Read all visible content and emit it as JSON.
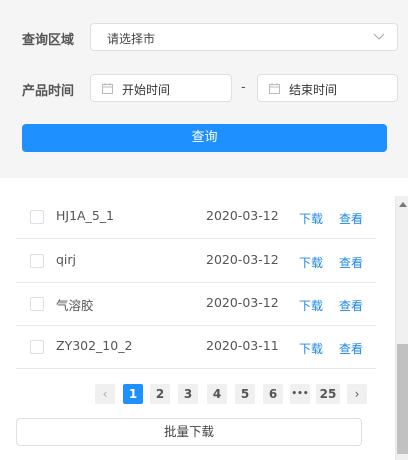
{
  "search": {
    "region_label": "查询区域",
    "region_value": "请选择市",
    "time_label": "产品时间",
    "start_placeholder": "开始时间",
    "date_separator": "-",
    "end_placeholder": "结束时间",
    "query_button": "查询"
  },
  "results": {
    "rows": [
      {
        "name": "HJ1A_5_1",
        "date": "2020-03-12",
        "download": "下载",
        "view": "查看"
      },
      {
        "name": "qirj",
        "date": "2020-03-12",
        "download": "下载",
        "view": "查看"
      },
      {
        "name": "气溶胶",
        "date": "2020-03-12",
        "download": "下载",
        "view": "查看"
      },
      {
        "name": "ZY302_10_2",
        "date": "2020-03-11",
        "download": "下载",
        "view": "查看"
      }
    ]
  },
  "pagination": {
    "prev": "‹",
    "pages": [
      "1",
      "2",
      "3",
      "4",
      "5",
      "6"
    ],
    "current": "1",
    "ellipsis": "•••",
    "last": "25",
    "next": "›"
  },
  "batch_download": "批量下载",
  "colors": {
    "accent": "#1e90ff",
    "link": "#1e88e5",
    "panel_bg": "#f5f5f5"
  },
  "icons": {
    "select": "chevron-down-icon",
    "date": "calendar-icon",
    "scroll": "scroll-up-arrow-icon"
  }
}
